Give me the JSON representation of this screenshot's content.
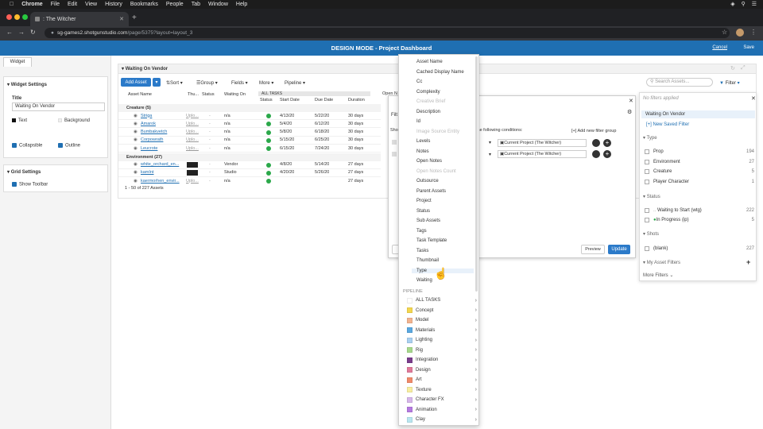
{
  "menubar": {
    "items": [
      "Chrome",
      "File",
      "Edit",
      "View",
      "History",
      "Bookmarks",
      "People",
      "Tab",
      "Window",
      "Help"
    ]
  },
  "browser": {
    "tab_title": ": The Witcher",
    "url_host": "sg-games2.shotgunstudio.com",
    "url_path": "/page/5375?layout=layout_3"
  },
  "design_bar": {
    "title": "DESIGN MODE - Project Dashboard",
    "cancel": "Cancel",
    "save": "Save"
  },
  "left_panel": {
    "tab": "Widget",
    "widget_settings": {
      "header": "Widget Settings",
      "title_label": "Title",
      "title_value": "Waiting On Vendor",
      "text_label": "Text",
      "background_label": "Background",
      "collapsible": "Collapsible",
      "outline": "Outline"
    },
    "grid_settings": {
      "header": "Grid Settings",
      "show_toolbar": "Show Toolbar"
    }
  },
  "widget": {
    "title": "Waiting On Vendor",
    "toolbar": {
      "add": "Add Asset",
      "sort": "Sort",
      "group": "Group",
      "fields": "Fields",
      "more": "More",
      "pipeline": "Pipeline",
      "search_placeholder": "Search Assets...",
      "filter": "Filter"
    },
    "all_tasks": "ALL TASKS",
    "open_notes": "Open N",
    "columns": [
      "Asset Name",
      "Thu...",
      "Status",
      "Waiting On",
      "Status",
      "Start Date",
      "Due Date",
      "Duration"
    ],
    "groups": [
      {
        "label": "Creature (5)",
        "rows": [
          {
            "name": "Striga",
            "thumb": "Uplo...",
            "status": "-",
            "waiting": "n/a",
            "start": "4/13/20",
            "due": "5/22/20",
            "duration": "30 days"
          },
          {
            "name": "Amarok",
            "thumb": "Uplo...",
            "status": "-",
            "waiting": "n/a",
            "start": "5/4/20",
            "due": "6/12/20",
            "duration": "30 days"
          },
          {
            "name": "Bumbakvetch",
            "thumb": "Uplo...",
            "status": "-",
            "waiting": "n/a",
            "start": "5/8/20",
            "due": "6/18/20",
            "duration": "30 days"
          },
          {
            "name": "Corpowrath",
            "thumb": "Uplo...",
            "status": "-",
            "waiting": "n/a",
            "start": "5/15/20",
            "due": "6/25/20",
            "duration": "30 days"
          },
          {
            "name": "Leucrote",
            "thumb": "Uplo...",
            "status": "-",
            "waiting": "n/a",
            "start": "6/15/20",
            "due": "7/24/20",
            "duration": "30 days"
          }
        ]
      },
      {
        "label": "Environment (27)",
        "rows": [
          {
            "name": "white_orchard_en...",
            "thumb": "",
            "status": "-",
            "waiting": "Vendor",
            "start": "4/8/20",
            "due": "5/14/20",
            "duration": "27 days"
          },
          {
            "name": "kamInt",
            "thumb": "",
            "status": "-",
            "waiting": "Studio",
            "start": "4/20/20",
            "due": "5/26/20",
            "duration": "27 days"
          },
          {
            "name": "kaermorhen_envir...",
            "thumb": "Uplo...",
            "status": "-",
            "waiting": "n/a",
            "start": "",
            "due": "",
            "duration": "27 days"
          }
        ]
      }
    ],
    "footer": "1 - 50 of 227 Assets"
  },
  "filter_dialog": {
    "title": "Filt",
    "show_label": "Sho",
    "condition_text": "the following conditions:",
    "add_group": "[+] Add new filter group",
    "value1": "Current Project (The Witcher)",
    "value2": "Current Project (The Witcher)",
    "preview": "Preview",
    "update": "Update"
  },
  "field_menu": {
    "items": [
      {
        "label": "Asset Name",
        "disabled": false
      },
      {
        "label": "Cached Display Name",
        "disabled": false
      },
      {
        "label": "Cc",
        "disabled": false
      },
      {
        "label": "Complexity",
        "disabled": false
      },
      {
        "label": "Creative Brief",
        "disabled": true
      },
      {
        "label": "Description",
        "disabled": false
      },
      {
        "label": "Id",
        "disabled": false
      },
      {
        "label": "Image Source Entity",
        "disabled": true
      },
      {
        "label": "Levels",
        "disabled": false
      },
      {
        "label": "Notes",
        "disabled": false
      },
      {
        "label": "Open Notes",
        "disabled": false
      },
      {
        "label": "Open Notes Count",
        "disabled": true
      },
      {
        "label": "Outsource",
        "disabled": false
      },
      {
        "label": "Parent Assets",
        "disabled": false
      },
      {
        "label": "Project",
        "disabled": false
      },
      {
        "label": "Status",
        "disabled": false
      },
      {
        "label": "Sub Assets",
        "disabled": false
      },
      {
        "label": "Tags",
        "disabled": false
      },
      {
        "label": "Task Template",
        "disabled": false
      },
      {
        "label": "Tasks",
        "disabled": false
      },
      {
        "label": "Thumbnail",
        "disabled": false
      },
      {
        "label": "Type",
        "disabled": false
      },
      {
        "label": "Waiting",
        "disabled": false
      }
    ],
    "pipeline_header": "PIPELINE",
    "pipeline": [
      {
        "label": "ALL TASKS",
        "color": "#ffffff"
      },
      {
        "label": "Concept",
        "color": "#f3d64f"
      },
      {
        "label": "Model",
        "color": "#f2b38f"
      },
      {
        "label": "Materials",
        "color": "#5aa8e0"
      },
      {
        "label": "Lighting",
        "color": "#a9d0f0"
      },
      {
        "label": "Rig",
        "color": "#a6d88c"
      },
      {
        "label": "Integration",
        "color": "#7a3d8c"
      },
      {
        "label": "Design",
        "color": "#e07a9a"
      },
      {
        "label": "Art",
        "color": "#f08a6a"
      },
      {
        "label": "Texture",
        "color": "#f8eea0"
      },
      {
        "label": "Character FX",
        "color": "#d6b6ea"
      },
      {
        "label": "Animation",
        "color": "#b57ae0"
      },
      {
        "label": "Clay",
        "color": "#b9e6f0"
      }
    ]
  },
  "right_panel": {
    "no_filters": "No filters applied",
    "saved": "Waiting On Vendor",
    "new_saved": "[+] New Saved Filter",
    "type_header": "Type",
    "types": [
      {
        "label": "Prop",
        "count": "194"
      },
      {
        "label": "Environment",
        "count": "27"
      },
      {
        "label": "Creature",
        "count": "5"
      },
      {
        "label": "Player Character",
        "count": "1"
      }
    ],
    "status_header": "Status",
    "statuses": [
      {
        "label": "Waiting to Start (wtg)",
        "count": "222"
      },
      {
        "label": "In Progress (ip)",
        "count": "5"
      }
    ],
    "shots_header": "Shots",
    "shots": [
      {
        "label": "(blank)",
        "count": "227"
      }
    ],
    "my_filters": "My Asset Filters",
    "more_filters": "More Filters"
  },
  "colors": {
    "accent": "#1f6fb2",
    "design_bar": "#1f6fb2",
    "button": "#2b7ac9"
  }
}
